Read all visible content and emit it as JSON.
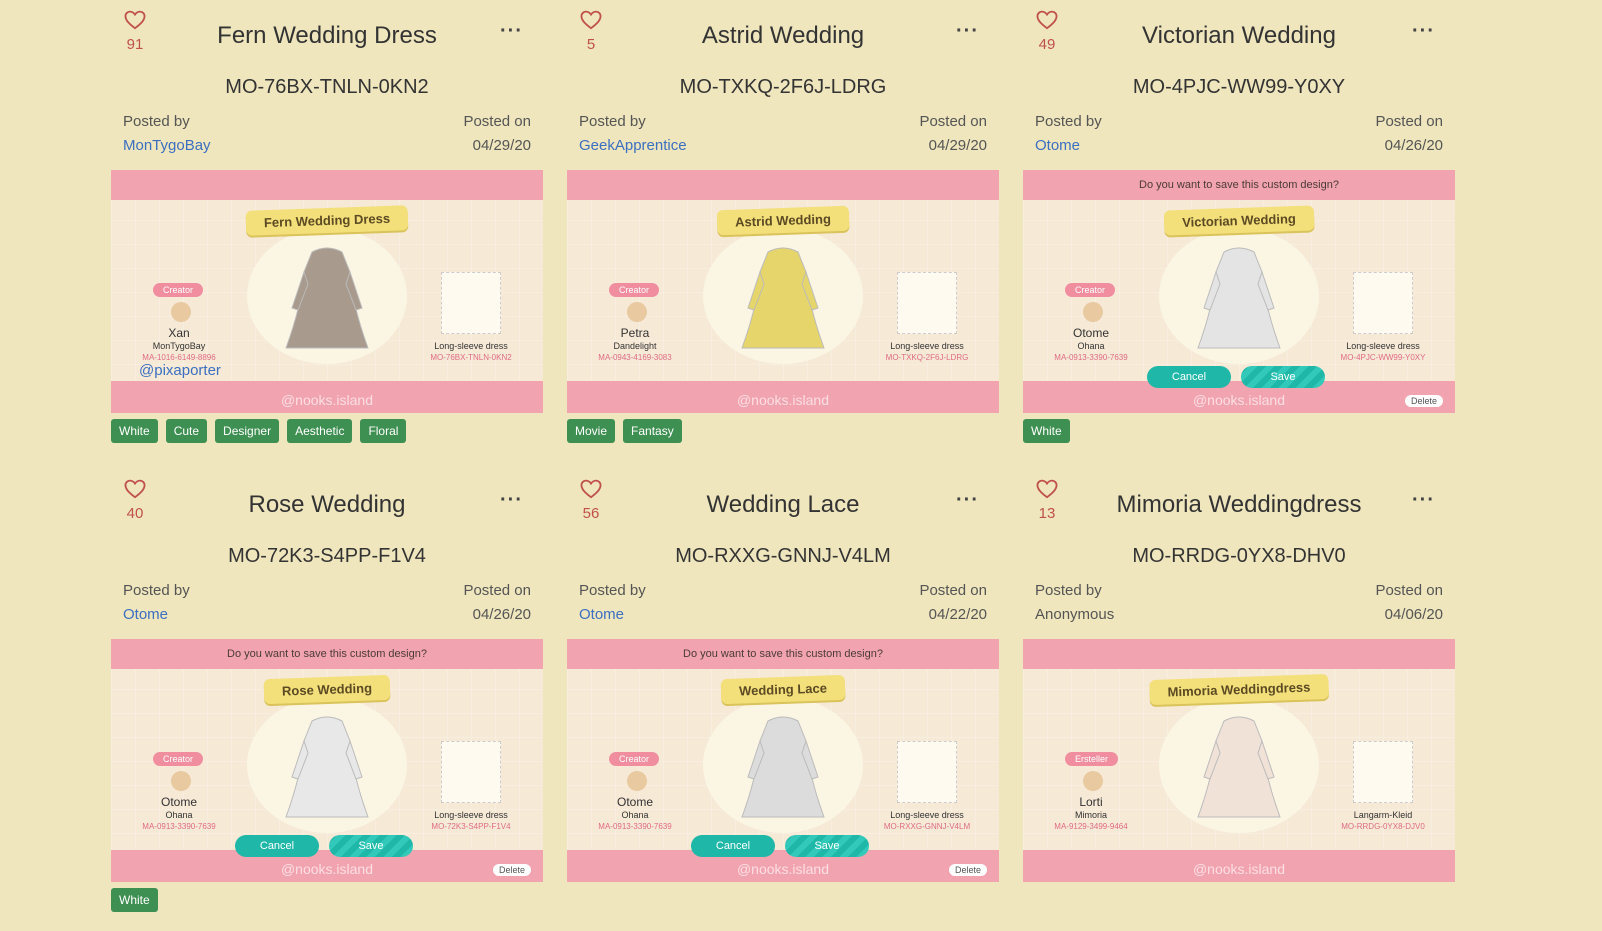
{
  "cards": [
    {
      "likes": "91",
      "title": "Fern Wedding Dress",
      "code": "MO-76BX-TNLN-0KN2",
      "posted_by_label": "Posted by",
      "author": "MonTygoBay",
      "posted_on_label": "Posted on",
      "date": "04/29/20",
      "shot": {
        "prompt": "",
        "ribbon": "Fern Wedding Dress",
        "creator_tag": "Creator",
        "creator_name": "Xan",
        "creator_island": "MonTygoBay",
        "creator_id": "MA-1016-6149-8896",
        "pattern_type": "Long-sleeve dress",
        "pattern_code": "MO-76BX-TNLN-0KN2",
        "handle": "@pixaporter",
        "watermark": "@nooks.island",
        "dress_color": "#a89a8c"
      },
      "tags": [
        "White",
        "Cute",
        "Designer",
        "Aesthetic",
        "Floral"
      ]
    },
    {
      "likes": "5",
      "title": "Astrid Wedding",
      "code": "MO-TXKQ-2F6J-LDRG",
      "posted_by_label": "Posted by",
      "author": "GeekApprentice",
      "posted_on_label": "Posted on",
      "date": "04/29/20",
      "shot": {
        "prompt": "",
        "ribbon": "Astrid Wedding",
        "creator_tag": "Creator",
        "creator_name": "Petra",
        "creator_island": "Dandelight",
        "creator_id": "MA-0943-4169-3083",
        "pattern_type": "Long-sleeve dress",
        "pattern_code": "MO-TXKQ-2F6J-LDRG",
        "handle": "",
        "watermark": "@nooks.island",
        "dress_color": "#e6d56a"
      },
      "tags": [
        "Movie",
        "Fantasy"
      ]
    },
    {
      "likes": "49",
      "title": "Victorian Wedding",
      "code": "MO-4PJC-WW99-Y0XY",
      "posted_by_label": "Posted by",
      "author": "Otome",
      "posted_on_label": "Posted on",
      "date": "04/26/20",
      "shot": {
        "prompt": "Do you want to save this custom design?",
        "ribbon": "Victorian Wedding",
        "creator_tag": "Creator",
        "creator_name": "Otome",
        "creator_island": "Ohana",
        "creator_id": "MA-0913-3390-7639",
        "pattern_type": "Long-sleeve dress",
        "pattern_code": "MO-4PJC-WW99-Y0XY",
        "handle": "",
        "watermark": "@nooks.island",
        "cancel": "Cancel",
        "save": "Save",
        "delete": "Delete",
        "dress_color": "#e4e4e4"
      },
      "tags": [
        "White"
      ]
    },
    {
      "likes": "40",
      "title": "Rose Wedding",
      "code": "MO-72K3-S4PP-F1V4",
      "posted_by_label": "Posted by",
      "author": "Otome",
      "posted_on_label": "Posted on",
      "date": "04/26/20",
      "shot": {
        "prompt": "Do you want to save this custom design?",
        "ribbon": "Rose Wedding",
        "creator_tag": "Creator",
        "creator_name": "Otome",
        "creator_island": "Ohana",
        "creator_id": "MA-0913-3390-7639",
        "pattern_type": "Long-sleeve dress",
        "pattern_code": "MO-72K3-S4PP-F1V4",
        "handle": "",
        "watermark": "@nooks.island",
        "cancel": "Cancel",
        "save": "Save",
        "delete": "Delete",
        "dress_color": "#e8e8e8"
      },
      "tags": [
        "White"
      ]
    },
    {
      "likes": "56",
      "title": "Wedding Lace",
      "code": "MO-RXXG-GNNJ-V4LM",
      "posted_by_label": "Posted by",
      "author": "Otome",
      "posted_on_label": "Posted on",
      "date": "04/22/20",
      "shot": {
        "prompt": "Do you want to save this custom design?",
        "ribbon": "Wedding Lace",
        "creator_tag": "Creator",
        "creator_name": "Otome",
        "creator_island": "Ohana",
        "creator_id": "MA-0913-3390-7639",
        "pattern_type": "Long-sleeve dress",
        "pattern_code": "MO-RXXG-GNNJ-V4LM",
        "handle": "",
        "watermark": "@nooks.island",
        "cancel": "Cancel",
        "save": "Save",
        "delete": "Delete",
        "dress_color": "#dcdcdc"
      },
      "tags": []
    },
    {
      "likes": "13",
      "title": "Mimoria Weddingdress",
      "code": "MO-RRDG-0YX8-DHV0",
      "posted_by_label": "Posted by",
      "author": "Anonymous",
      "posted_on_label": "Posted on",
      "date": "04/06/20",
      "shot": {
        "prompt": "",
        "ribbon": "Mimoria Weddingdress",
        "creator_tag": "Ersteller",
        "creator_name": "Lorti",
        "creator_island": "Mimoria",
        "creator_id": "MA-9129-3499-9464",
        "pattern_type": "Langarm-Kleid",
        "pattern_code": "MO-RRDG-0YX8-DJV0",
        "handle": "",
        "watermark": "@nooks.island",
        "dress_color": "#f1e2d8"
      },
      "tags": []
    }
  ]
}
